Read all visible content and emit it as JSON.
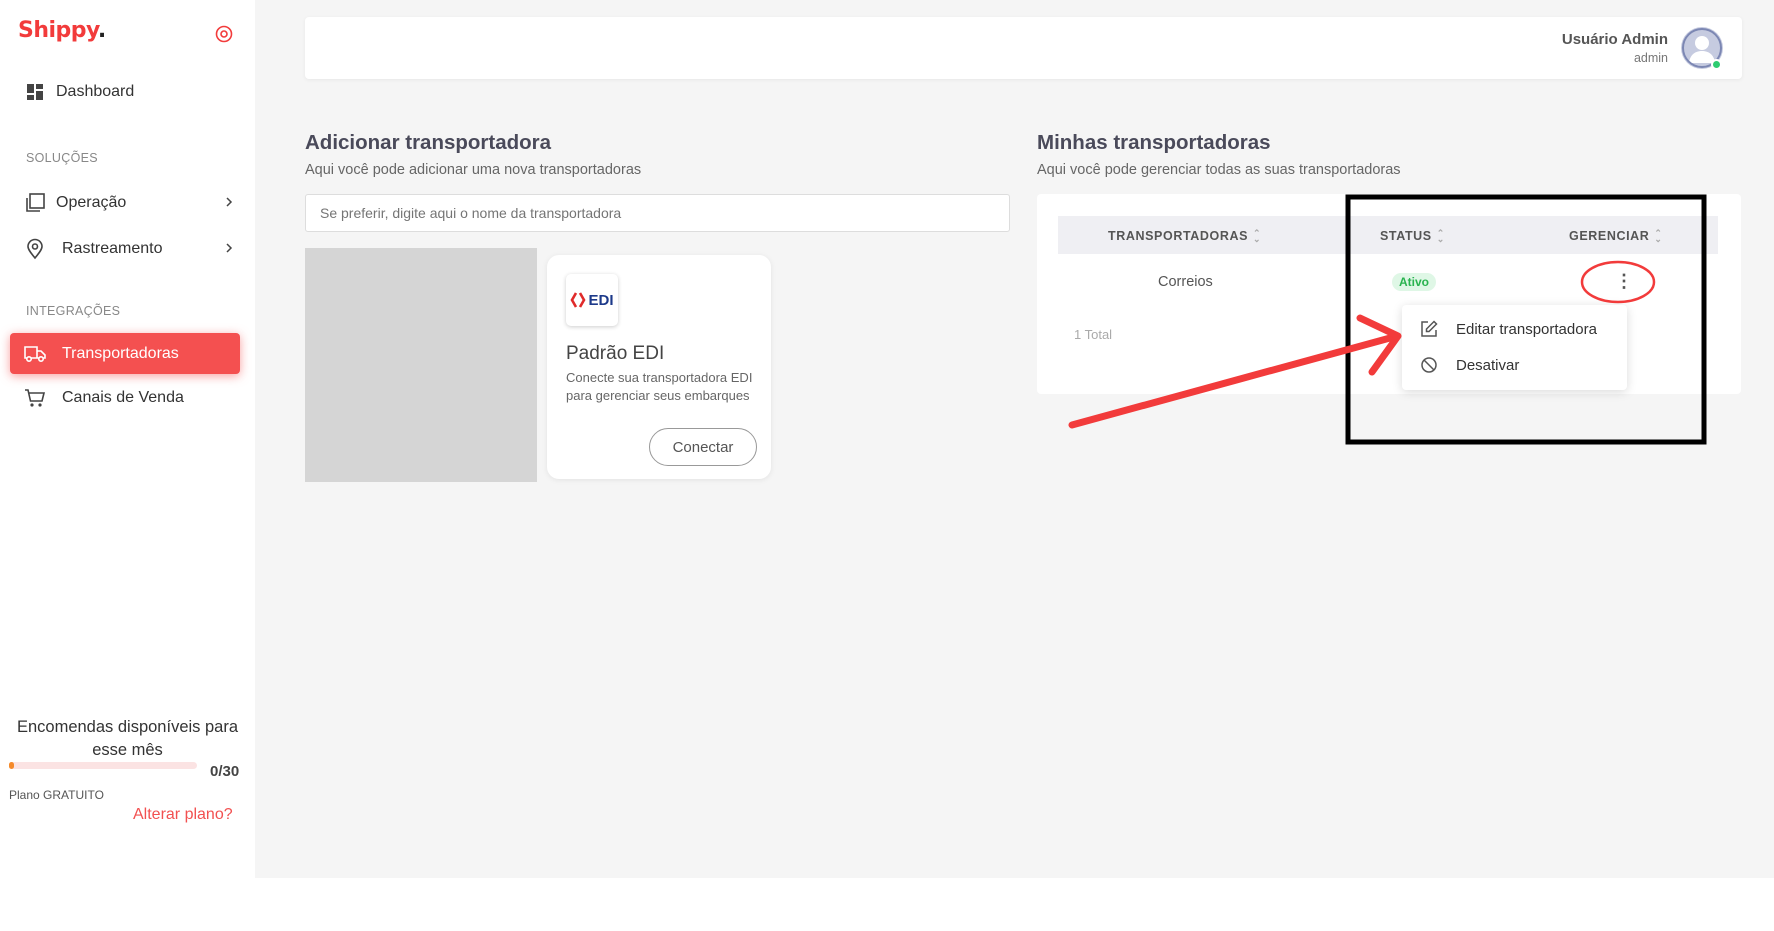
{
  "app": {
    "logo": "Shippy",
    "logo_dot": "."
  },
  "sidebar": {
    "items": [
      {
        "label": "Dashboard"
      },
      {
        "label": "Operação"
      },
      {
        "label": "Rastreamento"
      },
      {
        "label": "Transportadoras"
      },
      {
        "label": "Canais de Venda"
      }
    ],
    "sections": [
      "SOLUÇÕES",
      "INTEGRAÇÕES"
    ],
    "quota_title": "Encomendas disponíveis para esse mês",
    "quota_count": "0/30",
    "quota_progress": 0,
    "plan": "Plano GRATUITO",
    "change_plan": "Alterar plano?"
  },
  "user": {
    "name": "Usuário Admin",
    "role": "admin"
  },
  "add_section": {
    "title": "Adicionar transportadora",
    "subtitle": "Aqui você pode adicionar uma nova transportadoras",
    "search_placeholder": "Se preferir, digite aqui o nome da transportadora",
    "card": {
      "logo_text": "EDI",
      "title": "Padrão EDI",
      "description": "Conecte sua transportadora EDI para gerenciar seus embarques",
      "button": "Conectar"
    }
  },
  "my_section": {
    "title": "Minhas transportadoras",
    "subtitle": "Aqui você pode gerenciar todas as suas transportadoras",
    "columns": [
      "TRANSPORTADORAS",
      "STATUS",
      "GERENCIAR"
    ],
    "rows": [
      {
        "carrier": "Correios",
        "status": "Ativo"
      }
    ],
    "total": "1 Total",
    "menu": [
      "Editar transportadora",
      "Desativar"
    ]
  },
  "colors": {
    "brand": "#f23b3b",
    "active_bg": "#f45050",
    "status_green": "#29b34f",
    "annotation": "#f23b3b"
  }
}
